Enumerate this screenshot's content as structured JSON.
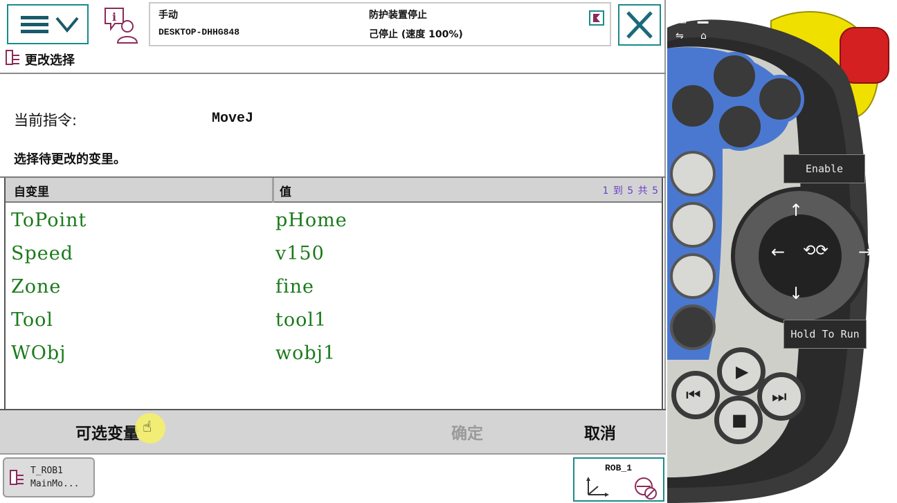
{
  "header": {
    "mode": "手动",
    "device": "DESKTOP-DHHG848",
    "safety_status": "防护装置停止",
    "run_status": "己停止 (速度 100%)"
  },
  "title": {
    "label": "更改选择"
  },
  "current_instruction": {
    "label": "当前指令:",
    "value": "MoveJ"
  },
  "instruction_text": "选择待更改的变里。",
  "table": {
    "columns": [
      "自变里",
      "值"
    ],
    "paging": "1 到 5 共 5",
    "rows": [
      {
        "arg": "ToPoint",
        "value": "pHome"
      },
      {
        "arg": "Speed",
        "value": "v150"
      },
      {
        "arg": "Zone",
        "value": "fine"
      },
      {
        "arg": "Tool",
        "value": "tool1"
      },
      {
        "arg": "WObj",
        "value": "wobj1"
      }
    ]
  },
  "buttons": {
    "optional_args": "可选变量",
    "ok": "确定",
    "cancel": "取消"
  },
  "taskbar": {
    "task_line1": "T_ROB1",
    "task_line2": "MainMo...",
    "robot": "ROB_1"
  },
  "hardware": {
    "enable_label": "Enable",
    "hold_label": "Hold To Run"
  },
  "colors": {
    "accent_teal": "#1a8a8a",
    "value_green": "#1a7a1a",
    "paging_purple": "#6b3fc4",
    "disabled_gray": "#9a9a9a",
    "controller_blue": "#4a78d0",
    "estop_red": "#d42020",
    "estop_yellow": "#f0e000"
  }
}
